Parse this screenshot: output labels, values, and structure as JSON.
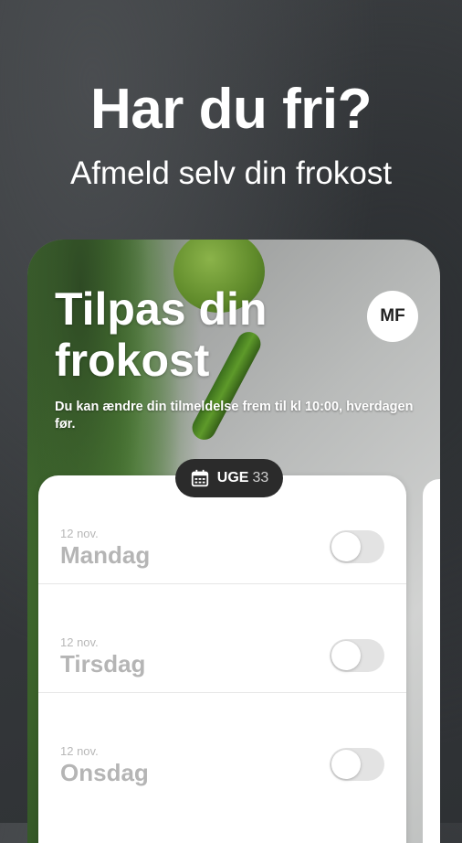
{
  "promo": {
    "headline": "Har du fri?",
    "subline": "Afmeld selv din frokost"
  },
  "app": {
    "title": "Tilpas din frokost",
    "avatar_initials": "MF",
    "description": "Du kan ændre din tilmeldelse frem til kl 10:00, hverdagen før.",
    "week": {
      "icon": "calendar-icon",
      "label": "UGE",
      "number": "33"
    },
    "days": [
      {
        "date": "12 nov.",
        "name": "Mandag",
        "enabled": false
      },
      {
        "date": "12 nov.",
        "name": "Tirsdag",
        "enabled": false
      },
      {
        "date": "12 nov.",
        "name": "Onsdag",
        "enabled": false
      }
    ]
  },
  "colors": {
    "pill_bg": "#2b2b2b",
    "toggle_off": "#e3e3e3",
    "muted_text": "#b5b5b5"
  }
}
